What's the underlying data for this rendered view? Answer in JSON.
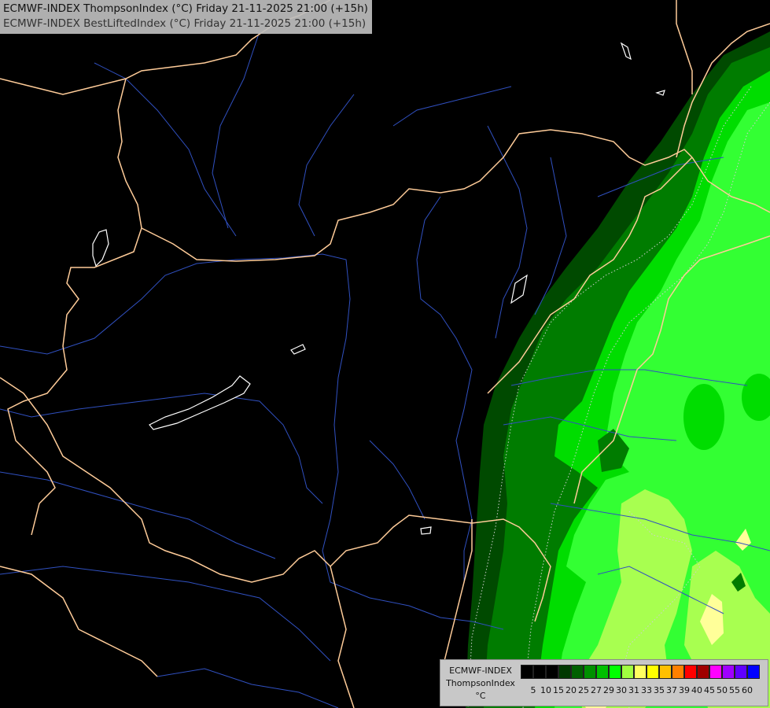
{
  "header": {
    "line1": "ECMWF-INDEX ThompsonIndex (°C) Friday 21-11-2025 21:00 (+15h)",
    "line2": "ECMWF-INDEX BestLiftedIndex (°C) Friday 21-11-2025 21:00 (+15h)"
  },
  "legend": {
    "line1": "ECMWF-INDEX",
    "line2": "ThompsonIndex",
    "line3": "°C",
    "ticks": [
      "5",
      "10",
      "15",
      "20",
      "25",
      "27",
      "29",
      "30",
      "31",
      "33",
      "35",
      "37",
      "39",
      "40",
      "45",
      "50",
      "55",
      "60"
    ],
    "colors": [
      "#000000",
      "#000000",
      "#000000",
      "#003800",
      "#006000",
      "#009000",
      "#00c000",
      "#00ff00",
      "#a0ff40",
      "#ffff60",
      "#ffff00",
      "#ffc000",
      "#ff8000",
      "#ff0000",
      "#a00000",
      "#ff00ff",
      "#a000ff",
      "#6000ff",
      "#0000ff"
    ]
  },
  "colors": {
    "background": "#000000",
    "border": "#ffcc99",
    "river": "#3050c0",
    "lake": "#ffffff",
    "green_dark": "#004a00",
    "green_mid": "#007c00",
    "green_bright": "#00dd00",
    "green_light": "#33ff33",
    "yellow_green": "#a8ff50",
    "pale_yellow": "#ffff99"
  }
}
